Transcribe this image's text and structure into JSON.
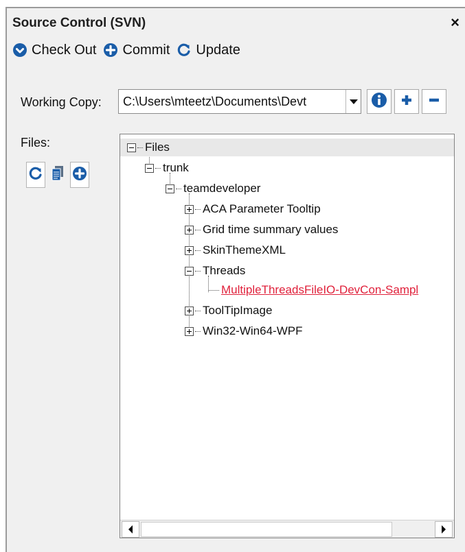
{
  "panel": {
    "title": "Source Control (SVN)",
    "close_label": "×"
  },
  "toolbar": {
    "checkout_label": "Check Out",
    "commit_label": "Commit",
    "update_label": "Update"
  },
  "working_copy": {
    "label": "Working Copy:",
    "value": "C:\\Users\\mteetz\\Documents\\Devt"
  },
  "files": {
    "label": "Files:"
  },
  "tree": {
    "root": "Files",
    "trunk": "trunk",
    "teamdeveloper": "teamdeveloper",
    "items": [
      "ACA Parameter Tooltip",
      "Grid time summary values",
      "SkinThemeXML",
      "Threads",
      "ToolTipImage",
      "Win32-Win64-WPF"
    ],
    "threads_child": "MultipleThreadsFileIO-DevCon-Sampl"
  },
  "colors": {
    "accent": "#1a5da8",
    "link_red": "#e0213b"
  }
}
